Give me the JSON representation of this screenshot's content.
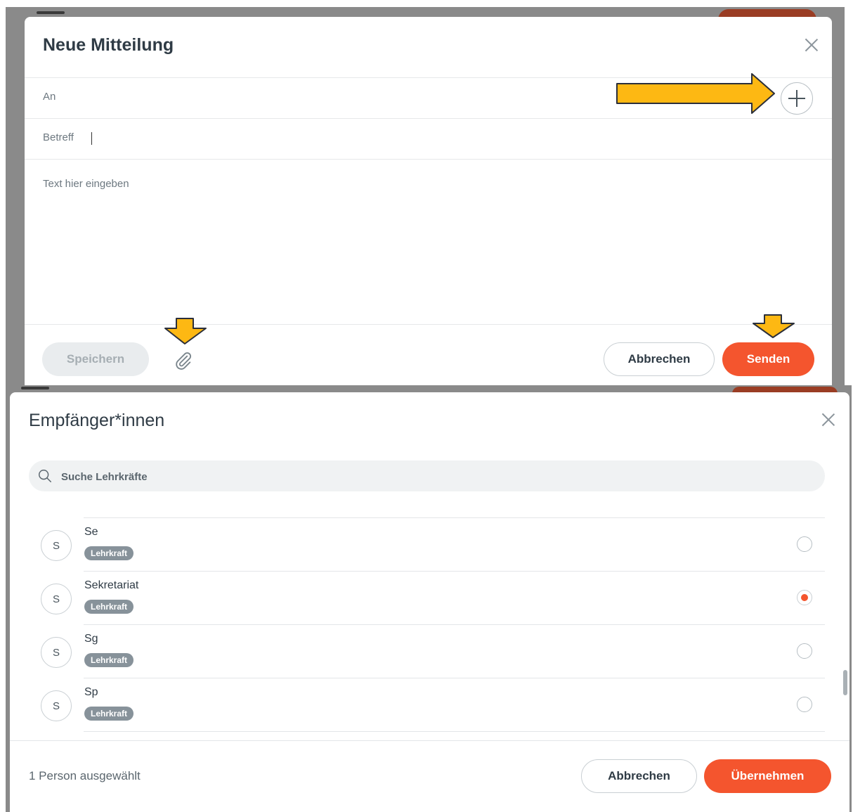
{
  "compose": {
    "title": "Neue Mitteilung",
    "to_label": "An",
    "subject_label": "Betreff",
    "body_placeholder": "Text hier eingeben",
    "save_label": "Speichern",
    "cancel_label": "Abbrechen",
    "send_label": "Senden"
  },
  "recipients": {
    "title": "Empfänger*innen",
    "search_placeholder": "Suche Lehrkräfte",
    "items": [
      {
        "initial": "S",
        "name": "Se",
        "badge": "Lehrkraft",
        "selected": false
      },
      {
        "initial": "S",
        "name": "Sekretariat",
        "badge": "Lehrkraft",
        "selected": true
      },
      {
        "initial": "S",
        "name": "Sg",
        "badge": "Lehrkraft",
        "selected": false
      },
      {
        "initial": "S",
        "name": "Sp",
        "badge": "Lehrkraft",
        "selected": false
      }
    ],
    "selected_count_text": "1 Person ausgewählt",
    "cancel_label": "Abbrechen",
    "apply_label": "Übernehmen"
  },
  "colors": {
    "accent": "#f4552e",
    "annotation_arrow": "#fdb813",
    "badge": "#87929a"
  },
  "icons": {
    "close": "close-icon",
    "add": "plus-icon",
    "attach": "paperclip-icon",
    "search": "search-icon"
  }
}
